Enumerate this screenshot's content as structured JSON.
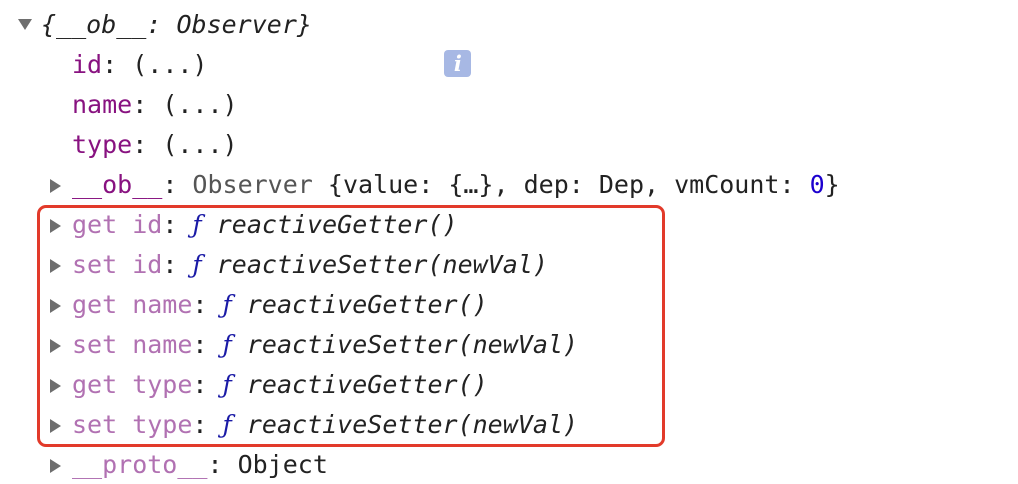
{
  "root": {
    "label": "{__ob__: Observer}",
    "info_badge": "i",
    "info_icon": "info-icon"
  },
  "properties": [
    {
      "key": "id",
      "value": "(...)"
    },
    {
      "key": "name",
      "value": "(...)"
    },
    {
      "key": "type",
      "value": "(...)"
    }
  ],
  "ob_row": {
    "key": "__ob__",
    "type_name": "Observer",
    "preview_open": "{value: ",
    "value_preview": "{…}",
    "sep1": ", dep: ",
    "dep": "Dep",
    "sep2": ", vmCount: ",
    "vm_count": "0",
    "preview_close": "}"
  },
  "accessors": [
    {
      "key": "get id",
      "f": "ƒ",
      "func": "reactiveGetter()"
    },
    {
      "key": "set id",
      "f": "ƒ",
      "func": "reactiveSetter(newVal)"
    },
    {
      "key": "get name",
      "f": "ƒ",
      "func": "reactiveGetter()"
    },
    {
      "key": "set name",
      "f": "ƒ",
      "func": "reactiveSetter(newVal)"
    },
    {
      "key": "get type",
      "f": "ƒ",
      "func": "reactiveGetter()"
    },
    {
      "key": "set type",
      "f": "ƒ",
      "func": "reactiveSetter(newVal)"
    }
  ],
  "proto": {
    "key": "__proto__",
    "value": "Object"
  },
  "colors": {
    "own_key": "#881280",
    "accessor_key": "#b171b2",
    "number": "#1c00cf",
    "highlight": "#e23a2a",
    "info_badge": "#a7b8e4"
  }
}
